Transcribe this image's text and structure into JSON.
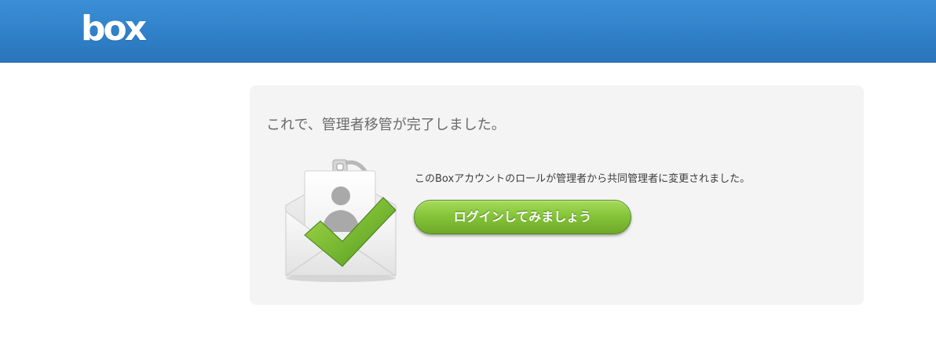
{
  "header": {
    "logo_text": "box",
    "background_color": "#2f80c8"
  },
  "panel": {
    "headline": "これで、管理者移管が完了しました。",
    "message": "このBoxアカウントのロールが管理者から共同管理者に変更されました。",
    "login_button_label": "ログインしてみましょう",
    "button_color": "#7cbf35",
    "illustration_icon": "envelope-badge-checkmark-icon"
  }
}
